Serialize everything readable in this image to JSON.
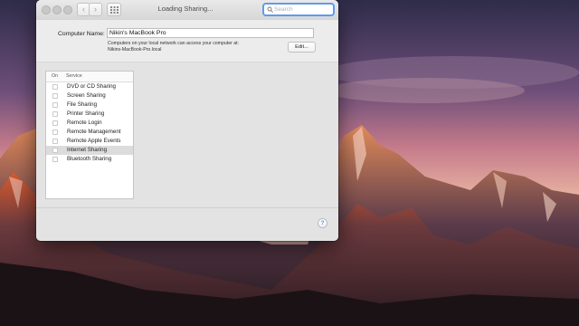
{
  "window": {
    "title": "Loading Sharing...",
    "back_symbol": "‹",
    "forward_symbol": "›"
  },
  "search": {
    "placeholder": "Search",
    "value": ""
  },
  "computer_name": {
    "label": "Computer Name:",
    "value": "Nikin's MacBook Pro",
    "description_line1": "Computers on your local network can access your computer at:",
    "description_line2": "Nikins-MacBook-Pro.local",
    "edit_label": "Edit..."
  },
  "services": {
    "header_on": "On",
    "header_service": "Service",
    "items": [
      {
        "label": "DVD or CD Sharing",
        "checked": false,
        "selected": false
      },
      {
        "label": "Screen Sharing",
        "checked": false,
        "selected": false
      },
      {
        "label": "File Sharing",
        "checked": false,
        "selected": false
      },
      {
        "label": "Printer Sharing",
        "checked": false,
        "selected": false
      },
      {
        "label": "Remote Login",
        "checked": false,
        "selected": false
      },
      {
        "label": "Remote Management",
        "checked": false,
        "selected": false
      },
      {
        "label": "Remote Apple Events",
        "checked": false,
        "selected": false
      },
      {
        "label": "Internet Sharing",
        "checked": false,
        "selected": true
      },
      {
        "label": "Bluetooth Sharing",
        "checked": false,
        "selected": false
      }
    ]
  },
  "help": {
    "symbol": "?"
  },
  "icons": {
    "grid": "grid-icon",
    "search": "search-icon",
    "help": "help-icon"
  },
  "colors": {
    "search_focus": "#5e9bf0",
    "selected_row": "#dcdcdc",
    "help_glyph": "#5b8ff0"
  }
}
